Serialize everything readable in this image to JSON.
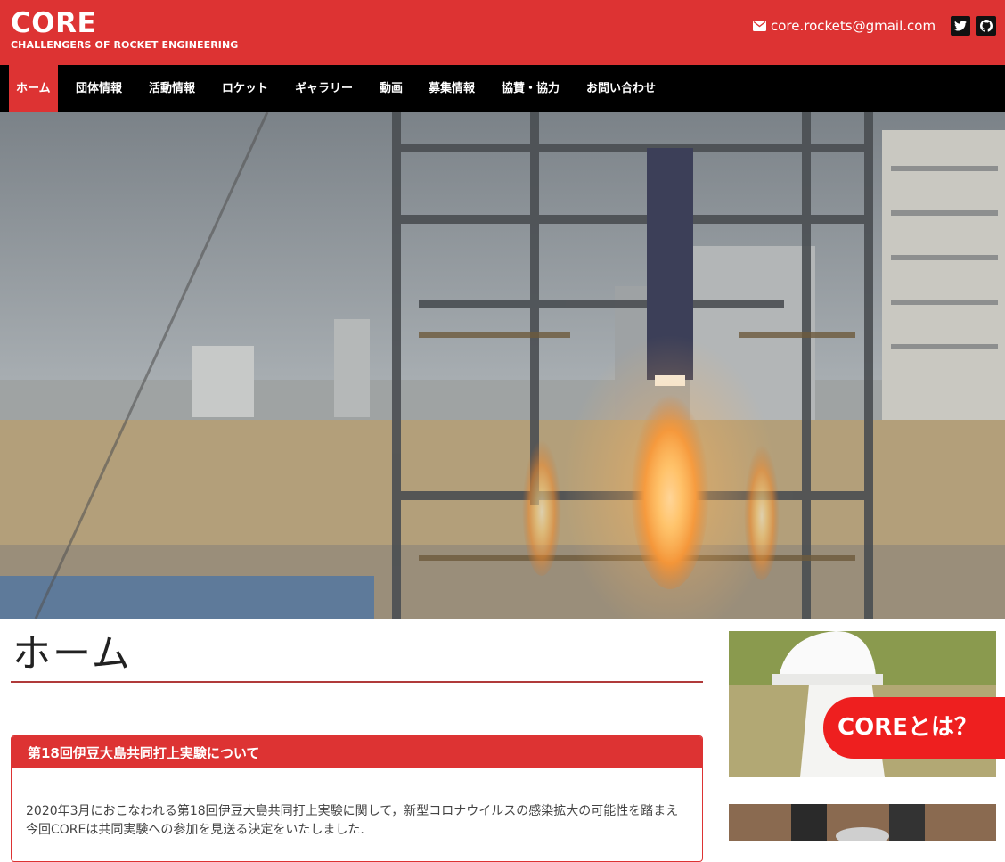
{
  "header": {
    "title": "CORE",
    "subtitle": "CHALLENGERS OF ROCKET ENGINEERING",
    "email": "core.rockets@gmail.com",
    "social": [
      {
        "icon": "twitter-icon"
      },
      {
        "icon": "github-icon"
      }
    ]
  },
  "nav": {
    "items": [
      {
        "label": "ホーム",
        "active": true
      },
      {
        "label": "団体情報"
      },
      {
        "label": "活動情報"
      },
      {
        "label": "ロケット"
      },
      {
        "label": "ギャラリー"
      },
      {
        "label": "動画"
      },
      {
        "label": "募集情報"
      },
      {
        "label": "協賛・協力"
      },
      {
        "label": "お問い合わせ"
      }
    ]
  },
  "main": {
    "page_title": "ホーム",
    "post": {
      "title": "第18回伊豆大島共同打上実験について",
      "body": "2020年3月におこなわれる第18回伊豆大島共同打上実験に関して，新型コロナウイルスの感染拡大の可能性を踏まえ今回COREは共同実験への参加を見送る決定をいたしました."
    }
  },
  "sidebar": {
    "cards": [
      {
        "label": "COREとは？"
      }
    ]
  },
  "colors": {
    "accent": "#dd3333",
    "nav_bg": "#000000",
    "sidebar_label": "#ee1f1f"
  }
}
